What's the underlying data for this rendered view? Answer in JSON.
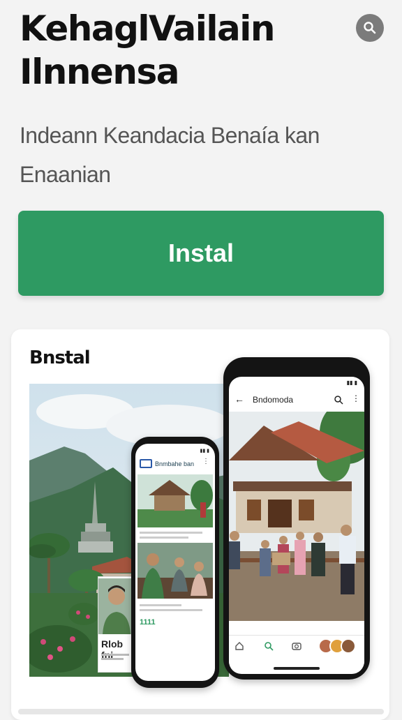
{
  "header": {
    "title": "KehaglVailain Ilnnensa",
    "search_icon": "search-icon"
  },
  "subtitle": "Indeann Keandacia Benaía kan Enaanian",
  "install_button": {
    "label": "Instal"
  },
  "preview_card": {
    "title": "Bnstal",
    "large_phone": {
      "header_title": "Bndomoda",
      "status_time": "",
      "nav_icons": [
        "home-icon",
        "search-icon",
        "camera-icon",
        "profile-icon"
      ]
    },
    "small_phone": {
      "header_title": "Bnmbahe ban",
      "post_text_1": "Rlob fni",
      "post_text_2": "1111"
    }
  },
  "colors": {
    "accent": "#2e9a62",
    "background": "#f3f3f3",
    "search_button": "#7b7b7b"
  }
}
